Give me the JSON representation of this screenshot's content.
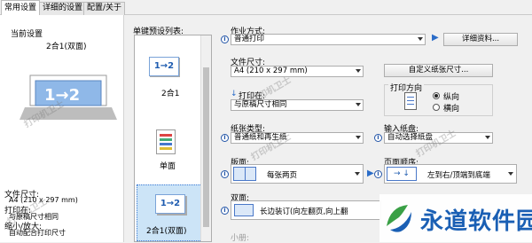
{
  "tabs": [
    {
      "label": "常用设置"
    },
    {
      "label": "详细的设置"
    },
    {
      "label": "配置/关于"
    }
  ],
  "current": {
    "header": "当前设置",
    "preview_label": "2合1(双面)",
    "info": {
      "paper_size_label": "文件尺寸:",
      "paper_size_value": "A4 (210 x 297 mm)",
      "print_on_label": "打印在:",
      "print_on_value": "与原稿尺寸相同",
      "zoom_label": "缩小/放大:",
      "zoom_value": "自动配合打印尺寸"
    }
  },
  "presets": {
    "title": "单键预设列表:",
    "items": [
      {
        "icon_text": "1→2",
        "label": "2合1"
      },
      {
        "icon_text": "",
        "label": "单面"
      },
      {
        "icon_text": "1→2",
        "label": "2合1(双面)"
      }
    ]
  },
  "settings": {
    "job_label": "作业方式:",
    "job_value": "普通打印",
    "detail_button": "详细资料...",
    "paper_size_label": "文件尺寸:",
    "paper_size_value": "A4 (210 x 297 mm)",
    "custom_size_button": "自定义纸张尺寸...",
    "print_on_label": "打印在:",
    "print_on_value": "与原稿尺寸相同",
    "orientation_label": "打印方向",
    "orientation_options": [
      "纵向",
      "横向"
    ],
    "media_label": "纸张类型:",
    "media_value": "普通纸和再生纸",
    "input_tray_label": "输入纸盘:",
    "input_tray_value": "自动选择纸盘",
    "layout_label": "版面:",
    "layout_value": "每张两页",
    "page_order_label": "页面顺序:",
    "page_order_value": "左到右/顶端到底端",
    "duplex_label": "双面:",
    "duplex_value": "长边装订(向左翻页,向上翻",
    "booklet_label": "小册:"
  },
  "watermark": "打印机卫士",
  "brand": {
    "text": "永道软件园",
    "color": "#1a5fb4",
    "accent": "#3aa046"
  }
}
